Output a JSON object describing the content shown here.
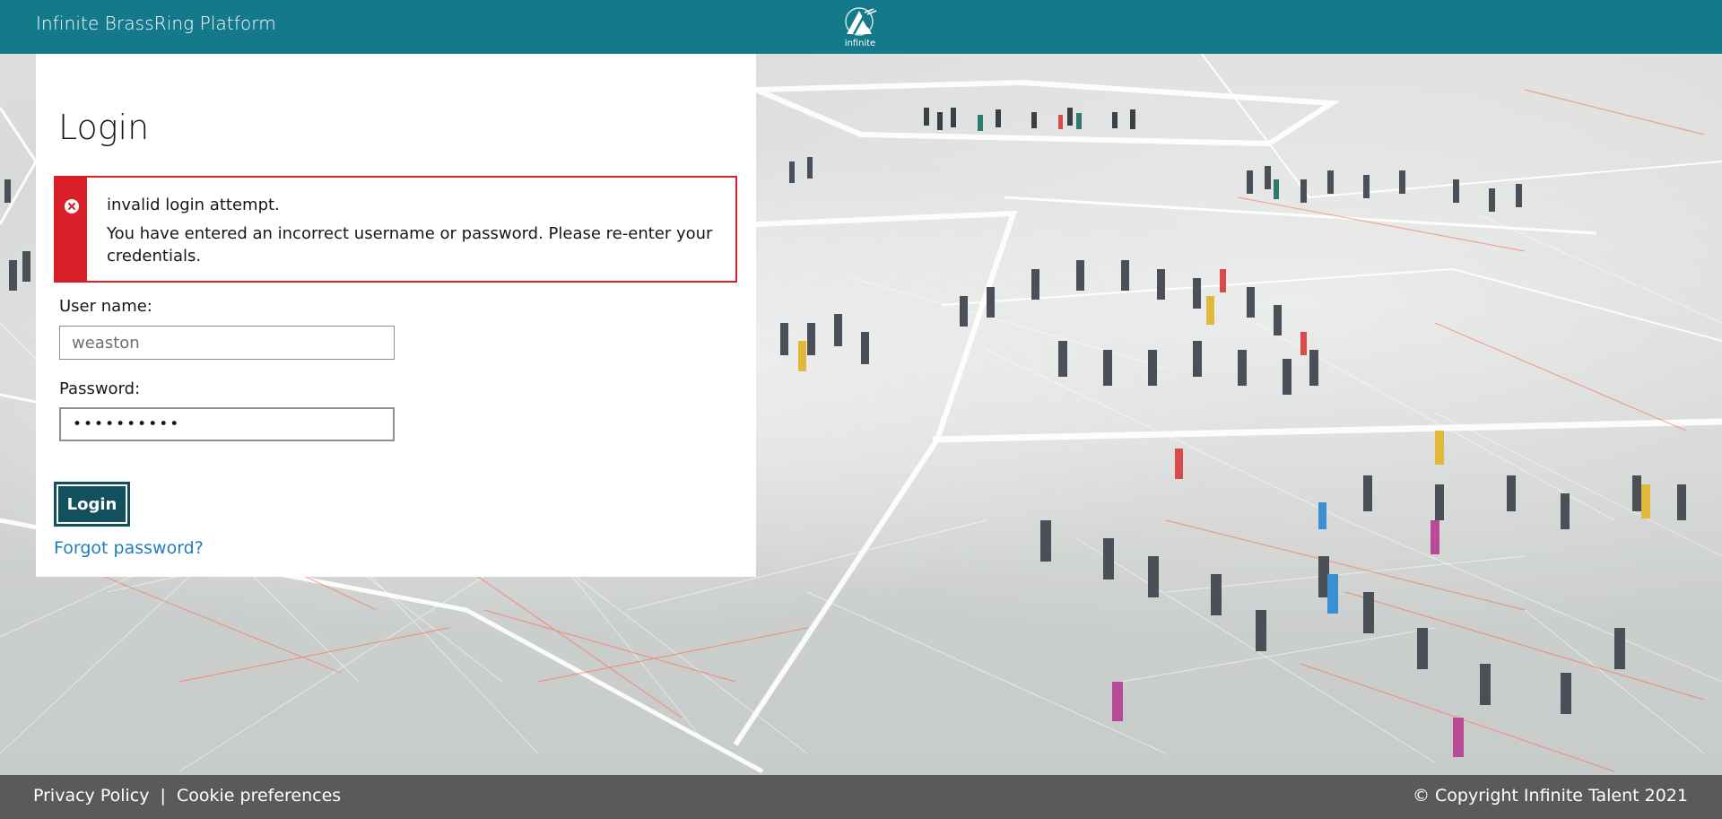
{
  "header": {
    "app_title": "Infinite BrassRing Platform",
    "logo_text": "infinite"
  },
  "login": {
    "title": "Login",
    "error": {
      "title": "invalid login attempt.",
      "message": "You have entered an incorrect username or password. Please re-enter your credentials."
    },
    "username_label": "User name:",
    "username_value": "weaston",
    "password_label": "Password:",
    "password_value": "••••••••••",
    "login_button": "Login",
    "forgot_link": "Forgot password?"
  },
  "footer": {
    "privacy_link": "Privacy Policy",
    "separator": "|",
    "cookie_link": "Cookie preferences",
    "copyright": "© Copyright Infinite Talent 2021"
  },
  "colors": {
    "header_bg": "#14798a",
    "error_red": "#da1e28",
    "button_bg": "#11505c",
    "link_blue": "#1b7fbd",
    "footer_bg": "#5a5a5a"
  }
}
